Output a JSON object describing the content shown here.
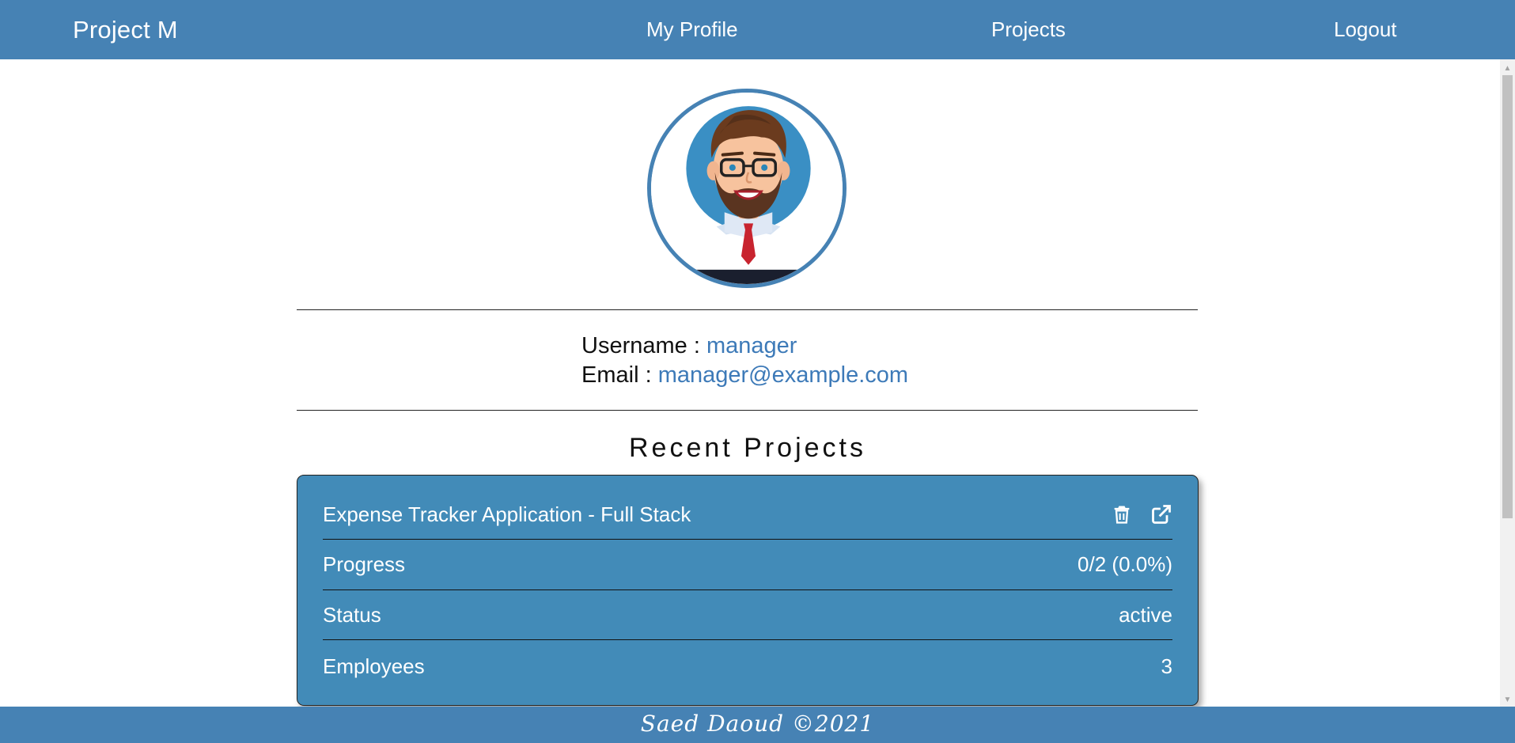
{
  "navbar": {
    "brand": "Project M",
    "links": [
      "My Profile",
      "Projects",
      "Logout"
    ]
  },
  "profile": {
    "avatar_alt": "manager avatar",
    "username_label": "Username :",
    "username": "manager",
    "email_label": "Email :",
    "email": "manager@example.com"
  },
  "recent_projects": {
    "title": "Recent Projects",
    "projects": [
      {
        "name": "Expense Tracker Application - Full Stack",
        "progress_label": "Progress",
        "progress_value": "0/2 (0.0%)",
        "status_label": "Status",
        "status_value": "active",
        "employees_label": "Employees",
        "employees_value": "3",
        "actions": [
          "trash-icon",
          "external-link-icon"
        ]
      }
    ]
  },
  "footer": {
    "text": "Saed Daoud ©2021"
  },
  "colors": {
    "navbar": "#4682b4",
    "card": "#428bb8",
    "link": "#3d7ab8"
  }
}
